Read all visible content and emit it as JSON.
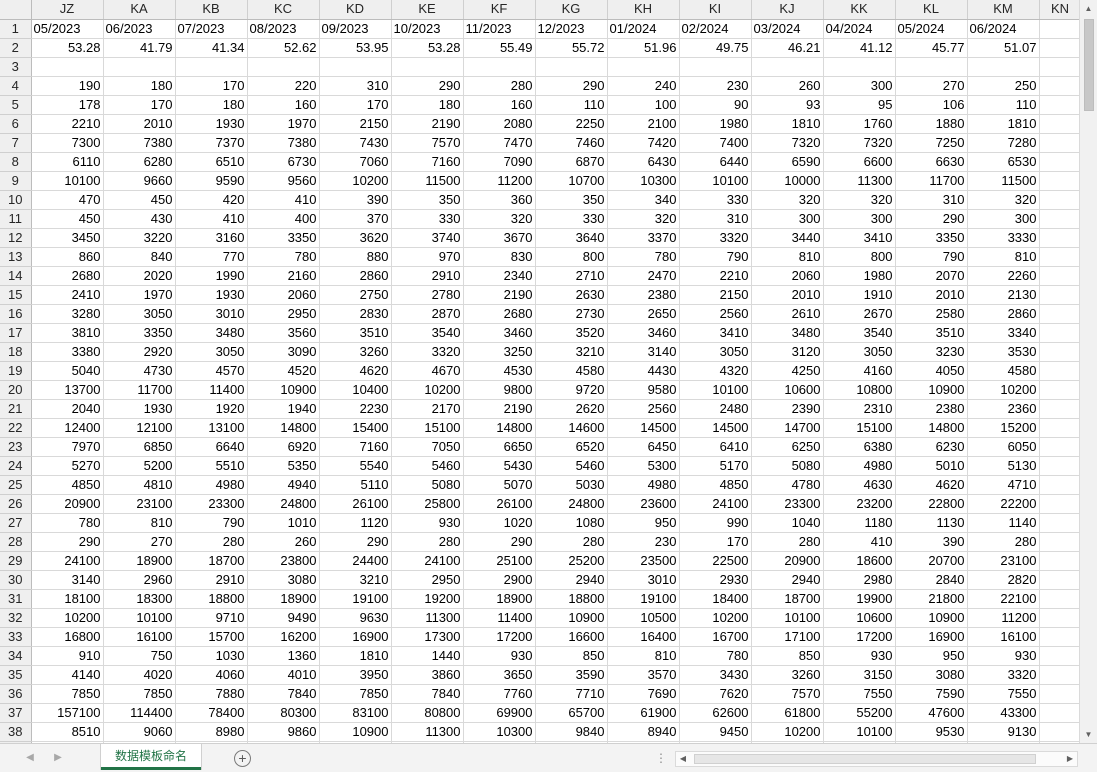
{
  "columns": [
    "JZ",
    "KA",
    "KB",
    "KC",
    "KD",
    "KE",
    "KF",
    "KG",
    "KH",
    "KI",
    "KJ",
    "KK",
    "KL",
    "KM",
    "KN"
  ],
  "rows": [
    {
      "n": "1",
      "cells": [
        "05/2023",
        "06/2023",
        "07/2023",
        "08/2023",
        "09/2023",
        "10/2023",
        "11/2023",
        "12/2023",
        "01/2024",
        "02/2024",
        "03/2024",
        "04/2024",
        "05/2024",
        "06/2024",
        ""
      ]
    },
    {
      "n": "2",
      "cells": [
        "53.28",
        "41.79",
        "41.34",
        "52.62",
        "53.95",
        "53.28",
        "55.49",
        "55.72",
        "51.96",
        "49.75",
        "46.21",
        "41.12",
        "45.77",
        "51.07",
        ""
      ]
    },
    {
      "n": "3",
      "cells": [
        "",
        "",
        "",
        "",
        "",
        "",
        "",
        "",
        "",
        "",
        "",
        "",
        "",
        "",
        ""
      ]
    },
    {
      "n": "4",
      "cells": [
        "190",
        "180",
        "170",
        "220",
        "310",
        "290",
        "280",
        "290",
        "240",
        "230",
        "260",
        "300",
        "270",
        "250",
        ""
      ]
    },
    {
      "n": "5",
      "cells": [
        "178",
        "170",
        "180",
        "160",
        "170",
        "180",
        "160",
        "110",
        "100",
        "90",
        "93",
        "95",
        "106",
        "110",
        ""
      ]
    },
    {
      "n": "6",
      "cells": [
        "2210",
        "2010",
        "1930",
        "1970",
        "2150",
        "2190",
        "2080",
        "2250",
        "2100",
        "1980",
        "1810",
        "1760",
        "1880",
        "1810",
        ""
      ]
    },
    {
      "n": "7",
      "cells": [
        "7300",
        "7380",
        "7370",
        "7380",
        "7430",
        "7570",
        "7470",
        "7460",
        "7420",
        "7400",
        "7320",
        "7320",
        "7250",
        "7280",
        ""
      ]
    },
    {
      "n": "8",
      "cells": [
        "6110",
        "6280",
        "6510",
        "6730",
        "7060",
        "7160",
        "7090",
        "6870",
        "6430",
        "6440",
        "6590",
        "6600",
        "6630",
        "6530",
        ""
      ]
    },
    {
      "n": "9",
      "cells": [
        "10100",
        "9660",
        "9590",
        "9560",
        "10200",
        "11500",
        "11200",
        "10700",
        "10300",
        "10100",
        "10000",
        "11300",
        "11700",
        "11500",
        ""
      ]
    },
    {
      "n": "10",
      "cells": [
        "470",
        "450",
        "420",
        "410",
        "390",
        "350",
        "360",
        "350",
        "340",
        "330",
        "320",
        "320",
        "310",
        "320",
        ""
      ]
    },
    {
      "n": "11",
      "cells": [
        "450",
        "430",
        "410",
        "400",
        "370",
        "330",
        "320",
        "330",
        "320",
        "310",
        "300",
        "300",
        "290",
        "300",
        ""
      ]
    },
    {
      "n": "12",
      "cells": [
        "3450",
        "3220",
        "3160",
        "3350",
        "3620",
        "3740",
        "3670",
        "3640",
        "3370",
        "3320",
        "3440",
        "3410",
        "3350",
        "3330",
        ""
      ]
    },
    {
      "n": "13",
      "cells": [
        "860",
        "840",
        "770",
        "780",
        "880",
        "970",
        "830",
        "800",
        "780",
        "790",
        "810",
        "800",
        "790",
        "810",
        ""
      ]
    },
    {
      "n": "14",
      "cells": [
        "2680",
        "2020",
        "1990",
        "2160",
        "2860",
        "2910",
        "2340",
        "2710",
        "2470",
        "2210",
        "2060",
        "1980",
        "2070",
        "2260",
        ""
      ]
    },
    {
      "n": "15",
      "cells": [
        "2410",
        "1970",
        "1930",
        "2060",
        "2750",
        "2780",
        "2190",
        "2630",
        "2380",
        "2150",
        "2010",
        "1910",
        "2010",
        "2130",
        ""
      ]
    },
    {
      "n": "16",
      "cells": [
        "3280",
        "3050",
        "3010",
        "2950",
        "2830",
        "2870",
        "2680",
        "2730",
        "2650",
        "2560",
        "2610",
        "2670",
        "2580",
        "2860",
        ""
      ]
    },
    {
      "n": "17",
      "cells": [
        "3810",
        "3350",
        "3480",
        "3560",
        "3510",
        "3540",
        "3460",
        "3520",
        "3460",
        "3410",
        "3480",
        "3540",
        "3510",
        "3340",
        ""
      ]
    },
    {
      "n": "18",
      "cells": [
        "3380",
        "2920",
        "3050",
        "3090",
        "3260",
        "3320",
        "3250",
        "3210",
        "3140",
        "3050",
        "3120",
        "3050",
        "3230",
        "3530",
        ""
      ]
    },
    {
      "n": "19",
      "cells": [
        "5040",
        "4730",
        "4570",
        "4520",
        "4620",
        "4670",
        "4530",
        "4580",
        "4430",
        "4320",
        "4250",
        "4160",
        "4050",
        "4580",
        ""
      ]
    },
    {
      "n": "20",
      "cells": [
        "13700",
        "11700",
        "11400",
        "10900",
        "10400",
        "10200",
        "9800",
        "9720",
        "9580",
        "10100",
        "10600",
        "10800",
        "10900",
        "10200",
        ""
      ]
    },
    {
      "n": "21",
      "cells": [
        "2040",
        "1930",
        "1920",
        "1940",
        "2230",
        "2170",
        "2190",
        "2620",
        "2560",
        "2480",
        "2390",
        "2310",
        "2380",
        "2360",
        ""
      ]
    },
    {
      "n": "22",
      "cells": [
        "12400",
        "12100",
        "13100",
        "14800",
        "15400",
        "15100",
        "14800",
        "14600",
        "14500",
        "14500",
        "14700",
        "15100",
        "14800",
        "15200",
        ""
      ]
    },
    {
      "n": "23",
      "cells": [
        "7970",
        "6850",
        "6640",
        "6920",
        "7160",
        "7050",
        "6650",
        "6520",
        "6450",
        "6410",
        "6250",
        "6380",
        "6230",
        "6050",
        ""
      ]
    },
    {
      "n": "24",
      "cells": [
        "5270",
        "5200",
        "5510",
        "5350",
        "5540",
        "5460",
        "5430",
        "5460",
        "5300",
        "5170",
        "5080",
        "4980",
        "5010",
        "5130",
        ""
      ]
    },
    {
      "n": "25",
      "cells": [
        "4850",
        "4810",
        "4980",
        "4940",
        "5110",
        "5080",
        "5070",
        "5030",
        "4980",
        "4850",
        "4780",
        "4630",
        "4620",
        "4710",
        ""
      ]
    },
    {
      "n": "26",
      "cells": [
        "20900",
        "23100",
        "23300",
        "24800",
        "26100",
        "25800",
        "26100",
        "24800",
        "23600",
        "24100",
        "23300",
        "23200",
        "22800",
        "22200",
        ""
      ]
    },
    {
      "n": "27",
      "cells": [
        "780",
        "810",
        "790",
        "1010",
        "1120",
        "930",
        "1020",
        "1080",
        "950",
        "990",
        "1040",
        "1180",
        "1130",
        "1140",
        ""
      ]
    },
    {
      "n": "28",
      "cells": [
        "290",
        "270",
        "280",
        "260",
        "290",
        "280",
        "290",
        "280",
        "230",
        "170",
        "280",
        "410",
        "390",
        "280",
        ""
      ]
    },
    {
      "n": "29",
      "cells": [
        "24100",
        "18900",
        "18700",
        "23800",
        "24400",
        "24100",
        "25100",
        "25200",
        "23500",
        "22500",
        "20900",
        "18600",
        "20700",
        "23100",
        ""
      ]
    },
    {
      "n": "30",
      "cells": [
        "3140",
        "2960",
        "2910",
        "3080",
        "3210",
        "2950",
        "2900",
        "2940",
        "3010",
        "2930",
        "2940",
        "2980",
        "2840",
        "2820",
        ""
      ]
    },
    {
      "n": "31",
      "cells": [
        "18100",
        "18300",
        "18800",
        "18900",
        "19100",
        "19200",
        "18900",
        "18800",
        "19100",
        "18400",
        "18700",
        "19900",
        "21800",
        "22100",
        ""
      ]
    },
    {
      "n": "32",
      "cells": [
        "10200",
        "10100",
        "9710",
        "9490",
        "9630",
        "11300",
        "11400",
        "10900",
        "10500",
        "10200",
        "10100",
        "10600",
        "10900",
        "11200",
        ""
      ]
    },
    {
      "n": "33",
      "cells": [
        "16800",
        "16100",
        "15700",
        "16200",
        "16900",
        "17300",
        "17200",
        "16600",
        "16400",
        "16700",
        "17100",
        "17200",
        "16900",
        "16100",
        ""
      ]
    },
    {
      "n": "34",
      "cells": [
        "910",
        "750",
        "1030",
        "1360",
        "1810",
        "1440",
        "930",
        "850",
        "810",
        "780",
        "850",
        "930",
        "950",
        "930",
        ""
      ]
    },
    {
      "n": "35",
      "cells": [
        "4140",
        "4020",
        "4060",
        "4010",
        "3950",
        "3860",
        "3650",
        "3590",
        "3570",
        "3430",
        "3260",
        "3150",
        "3080",
        "3320",
        ""
      ]
    },
    {
      "n": "36",
      "cells": [
        "7850",
        "7850",
        "7880",
        "7840",
        "7850",
        "7840",
        "7760",
        "7710",
        "7690",
        "7620",
        "7570",
        "7550",
        "7590",
        "7550",
        ""
      ]
    },
    {
      "n": "37",
      "cells": [
        "157100",
        "114400",
        "78400",
        "80300",
        "83100",
        "80800",
        "69900",
        "65700",
        "61900",
        "62600",
        "61800",
        "55200",
        "47600",
        "43300",
        ""
      ]
    },
    {
      "n": "38",
      "cells": [
        "8510",
        "9060",
        "8980",
        "9860",
        "10900",
        "11300",
        "10300",
        "9840",
        "8940",
        "9450",
        "10200",
        "10100",
        "9530",
        "9130",
        ""
      ]
    },
    {
      "n": "39",
      "cells": [
        "",
        "",
        "",
        "",
        "",
        "",
        "",
        "",
        "",
        "",
        "",
        "",
        "",
        "",
        ""
      ]
    }
  ],
  "sheet_tab": {
    "label": "数据模板命名"
  },
  "icons": {
    "add_sheet": "plus-circle-icon",
    "scroll_up": "triangle-up-icon",
    "scroll_down": "triangle-down-icon",
    "scroll_left": "triangle-left-icon",
    "scroll_right": "triangle-right-icon",
    "more": "ellipsis-icon"
  },
  "colors": {
    "accent": "#217346",
    "header_bg": "#efefef",
    "gridline": "#d9d9d9"
  }
}
